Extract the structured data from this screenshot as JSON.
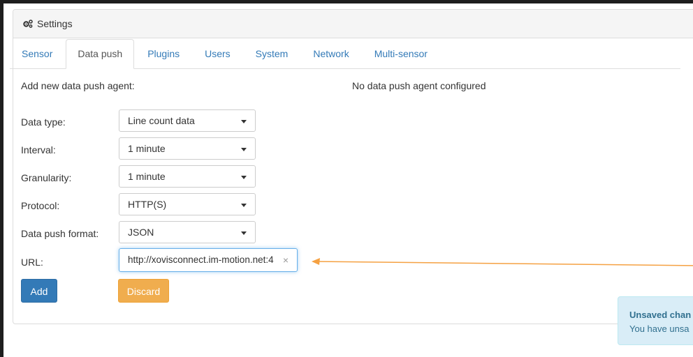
{
  "panel": {
    "title": "Settings",
    "icon": "gears-icon"
  },
  "tabs": [
    {
      "label": "Sensor",
      "active": false
    },
    {
      "label": "Data push",
      "active": true
    },
    {
      "label": "Plugins",
      "active": false
    },
    {
      "label": "Users",
      "active": false
    },
    {
      "label": "System",
      "active": false
    },
    {
      "label": "Network",
      "active": false
    },
    {
      "label": "Multi-sensor",
      "active": false
    }
  ],
  "form": {
    "heading": "Add new data push agent:",
    "empty_message": "No data push agent configured",
    "fields": {
      "data_type": {
        "label": "Data type:",
        "value": "Line count data"
      },
      "interval": {
        "label": "Interval:",
        "value": "1 minute"
      },
      "granularity": {
        "label": "Granularity:",
        "value": "1 minute"
      },
      "protocol": {
        "label": "Protocol:",
        "value": "HTTP(S)"
      },
      "format": {
        "label": "Data push format:",
        "value": "JSON"
      },
      "url": {
        "label": "URL:",
        "value": "http://xovisconnect.im-motion.net:4"
      }
    },
    "add_label": "Add",
    "discard_label": "Discard"
  },
  "toast": {
    "title": "Unsaved chan",
    "message": "You have unsa"
  },
  "colors": {
    "primary": "#337ab7",
    "warning": "#f0ad4e",
    "annotation_arrow": "#f5a142",
    "info_bg": "#d9edf7"
  }
}
